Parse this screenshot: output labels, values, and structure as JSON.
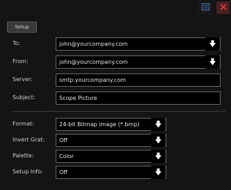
{
  "toolbar": {
    "setup_label": "Setup"
  },
  "email": {
    "to": {
      "label": "To:",
      "value": "john@yourcompany.com"
    },
    "from": {
      "label": "From:",
      "value": "john@yourcompany.com"
    },
    "server": {
      "label": "Server:",
      "value": "smtp.yourcompany.com"
    },
    "subject": {
      "label": "Subject:",
      "value": "Scope Picture"
    }
  },
  "options": {
    "format": {
      "label": "Format:",
      "value": "24-bit Bitmap image (*.bmp)"
    },
    "invert_grat": {
      "label": "Invert Grat:",
      "value": "Off"
    },
    "palette": {
      "label": "Palette:",
      "value": "Color"
    },
    "setup_info": {
      "label": "Setup Info:",
      "value": "Off"
    }
  },
  "icons": {
    "menu": "menu-icon",
    "close": "close-icon",
    "dropdown": "down-arrow-icon"
  },
  "colors": {
    "background": "#141414",
    "field_border": "#6a6a6a",
    "close_bg": "#4a2020",
    "close_x": "#e03a3a",
    "menu_icon": "#4a7ab8"
  }
}
